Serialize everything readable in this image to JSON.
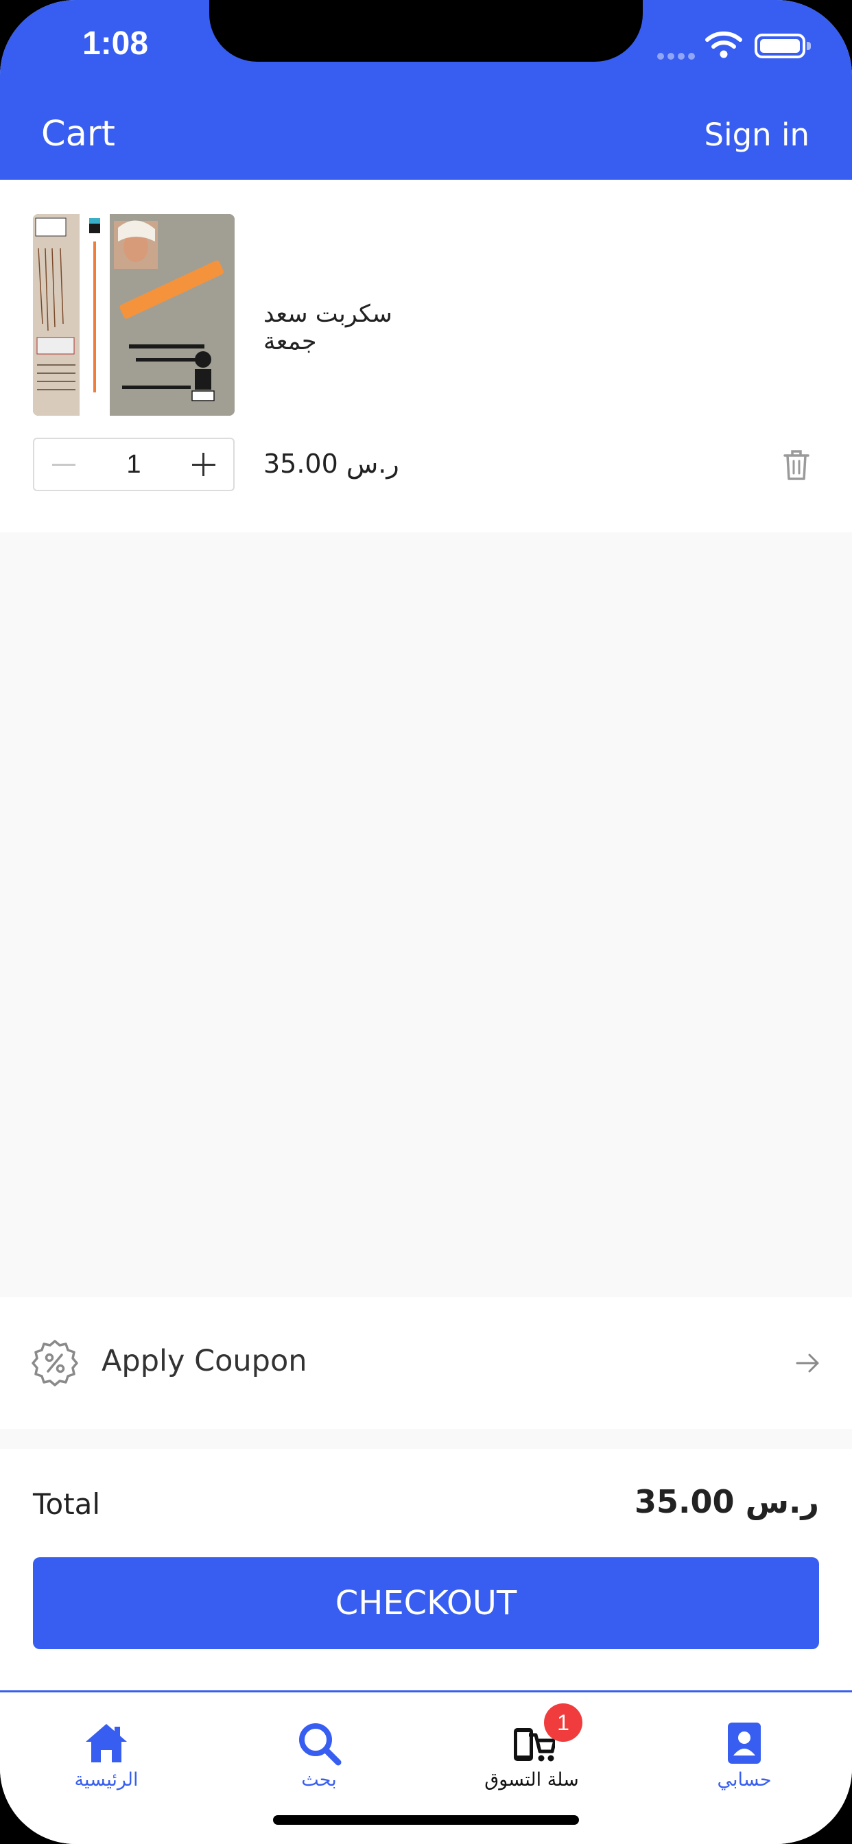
{
  "status_bar": {
    "time": "1:08"
  },
  "nav": {
    "title": "Cart",
    "sign_in": "Sign in"
  },
  "cart_item": {
    "title": "سكربت سعد جمعة",
    "quantity": "1",
    "price": "35.00 ر.س"
  },
  "coupon": {
    "label": "Apply Coupon"
  },
  "summary": {
    "total_label": "Total",
    "total_value": "35.00 ر.س"
  },
  "checkout": {
    "label": "CHECKOUT"
  },
  "tabs": [
    {
      "label": "الرئيسية",
      "icon": "home-icon"
    },
    {
      "label": "بحث",
      "icon": "search-icon"
    },
    {
      "label": "سلة التسوق",
      "icon": "cart-icon",
      "badge": "1"
    },
    {
      "label": "حسابي",
      "icon": "account-icon"
    }
  ],
  "colors": {
    "accent": "#375ef0",
    "badge": "#f03c3c",
    "background": "#f9f9f9"
  }
}
